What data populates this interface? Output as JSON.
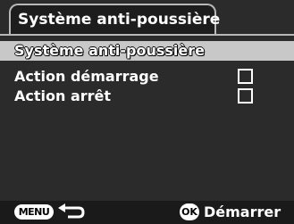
{
  "header": {
    "title": "Système anti-poussière"
  },
  "menu": {
    "items": [
      {
        "label": "Système anti-poussière",
        "selected": true
      },
      {
        "label": "Action démarrage",
        "checked": false
      },
      {
        "label": "Action arrêt",
        "checked": false
      }
    ]
  },
  "footer": {
    "menu_button_label": "MENU",
    "back_icon": "back-arrow-icon",
    "ok_button_label": "OK",
    "ok_action_label": "Démarrer"
  },
  "colors": {
    "background": "#2b2b2b",
    "selected_row": "#c8c8c8",
    "tab_border": "#b8b8b8",
    "text": "#ffffff"
  }
}
